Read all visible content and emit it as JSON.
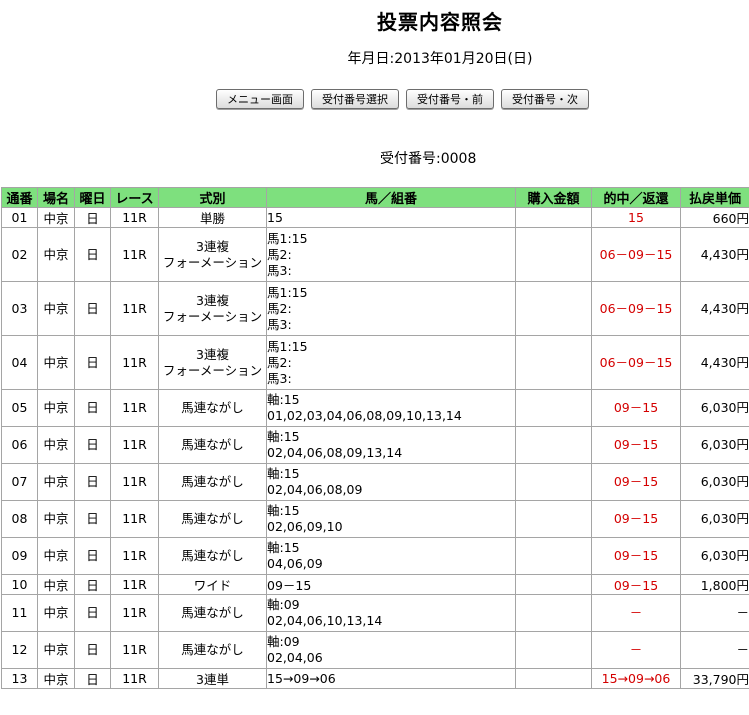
{
  "page": {
    "title": "投票内容照会",
    "date": "年月日:2013年01月20日(日)",
    "receipt": "受付番号:0008"
  },
  "buttons": {
    "menu": "メニュー画面",
    "select": "受付番号選択",
    "prev": "受付番号・前",
    "next": "受付番号・次"
  },
  "table": {
    "headers": {
      "no": "通番",
      "venue": "場名",
      "day": "曜日",
      "race": "レース",
      "type": "式別",
      "combo": "馬／組番",
      "amount": "購入金額",
      "hit": "的中／返還",
      "payout": "払戻単価"
    },
    "rows": [
      {
        "no": "01",
        "venue": "中京",
        "day": "日",
        "race": "11R",
        "type": "単勝",
        "combo": "15",
        "amount": "",
        "hit": "15",
        "payout": "660円"
      },
      {
        "no": "02",
        "venue": "中京",
        "day": "日",
        "race": "11R",
        "type": "3連複\nフォーメーション",
        "combo": "馬1:15\n馬2:\n馬3:",
        "amount": "",
        "hit": "06－09－15",
        "payout": "4,430円"
      },
      {
        "no": "03",
        "venue": "中京",
        "day": "日",
        "race": "11R",
        "type": "3連複\nフォーメーション",
        "combo": "馬1:15\n馬2:\n馬3:",
        "amount": "",
        "hit": "06－09－15",
        "payout": "4,430円"
      },
      {
        "no": "04",
        "venue": "中京",
        "day": "日",
        "race": "11R",
        "type": "3連複\nフォーメーション",
        "combo": "馬1:15\n馬2:\n馬3:",
        "amount": "",
        "hit": "06－09－15",
        "payout": "4,430円"
      },
      {
        "no": "05",
        "venue": "中京",
        "day": "日",
        "race": "11R",
        "type": "馬連ながし",
        "combo": "軸:15\n01,02,03,04,06,08,09,10,13,14",
        "amount": "",
        "hit": "09－15",
        "payout": "6,030円"
      },
      {
        "no": "06",
        "venue": "中京",
        "day": "日",
        "race": "11R",
        "type": "馬連ながし",
        "combo": "軸:15\n02,04,06,08,09,13,14",
        "amount": "",
        "hit": "09－15",
        "payout": "6,030円"
      },
      {
        "no": "07",
        "venue": "中京",
        "day": "日",
        "race": "11R",
        "type": "馬連ながし",
        "combo": "軸:15\n02,04,06,08,09",
        "amount": "",
        "hit": "09－15",
        "payout": "6,030円"
      },
      {
        "no": "08",
        "venue": "中京",
        "day": "日",
        "race": "11R",
        "type": "馬連ながし",
        "combo": "軸:15\n02,06,09,10",
        "amount": "",
        "hit": "09－15",
        "payout": "6,030円"
      },
      {
        "no": "09",
        "venue": "中京",
        "day": "日",
        "race": "11R",
        "type": "馬連ながし",
        "combo": "軸:15\n04,06,09",
        "amount": "",
        "hit": "09－15",
        "payout": "6,030円"
      },
      {
        "no": "10",
        "venue": "中京",
        "day": "日",
        "race": "11R",
        "type": "ワイド",
        "combo": "09－15",
        "amount": "",
        "hit": "09－15",
        "payout": "1,800円"
      },
      {
        "no": "11",
        "venue": "中京",
        "day": "日",
        "race": "11R",
        "type": "馬連ながし",
        "combo": "軸:09\n02,04,06,10,13,14",
        "amount": "",
        "hit": "－",
        "payout": "－"
      },
      {
        "no": "12",
        "venue": "中京",
        "day": "日",
        "race": "11R",
        "type": "馬連ながし",
        "combo": "軸:09\n02,04,06",
        "amount": "",
        "hit": "－",
        "payout": "－"
      },
      {
        "no": "13",
        "venue": "中京",
        "day": "日",
        "race": "11R",
        "type": "3連単",
        "combo": "15→09→06",
        "amount": "",
        "hit": "15→09→06",
        "payout": "33,790円"
      }
    ]
  }
}
